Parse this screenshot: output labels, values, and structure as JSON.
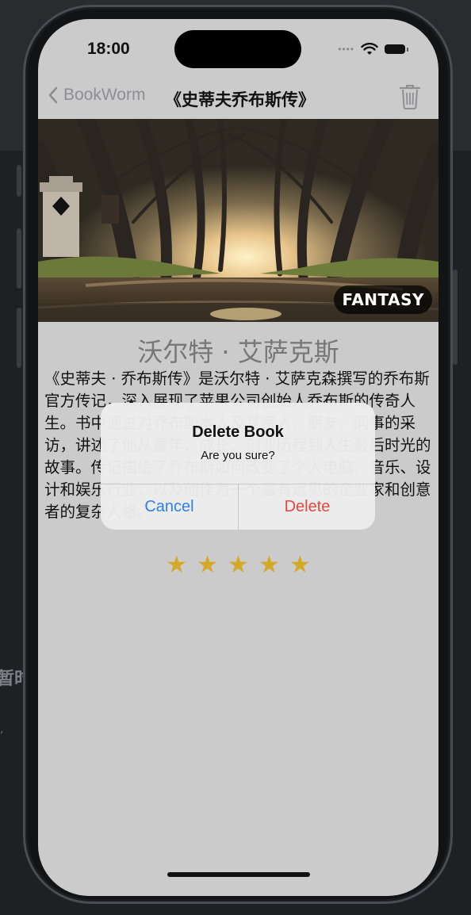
{
  "background": {
    "text_1": "暂时",
    "text_2": ","
  },
  "status_bar": {
    "time": "18:00"
  },
  "nav": {
    "back_label": "BookWorm",
    "title": "《史蒂夫乔布斯传》"
  },
  "book": {
    "genre": "FANTASY",
    "author": "沃尔特 · 艾萨克斯",
    "review": "《史蒂夫 · 乔布斯传》是沃尔特 · 艾萨克森撰写的乔布斯官方传记，深入展现了苹果公司创始人乔布斯的传奇人生。书中通过对乔布斯本人及其家人、朋友、同事的采访，讲述了他从童年、成长、创业历程到人生最后时光的故事。传记描绘了乔布斯如何改变了个人电脑、音乐、设计和娱乐行业，以及他作为一个富有远见的企业家和创意者的复杂人格。",
    "rating": 5,
    "star_glyph": "★"
  },
  "alert": {
    "title": "Delete Book",
    "message": "Are you sure?",
    "cancel_label": "Cancel",
    "delete_label": "Delete"
  },
  "colors": {
    "cancel": "#2f7fe6",
    "delete": "#e0493f",
    "star": "#d4a92a"
  }
}
